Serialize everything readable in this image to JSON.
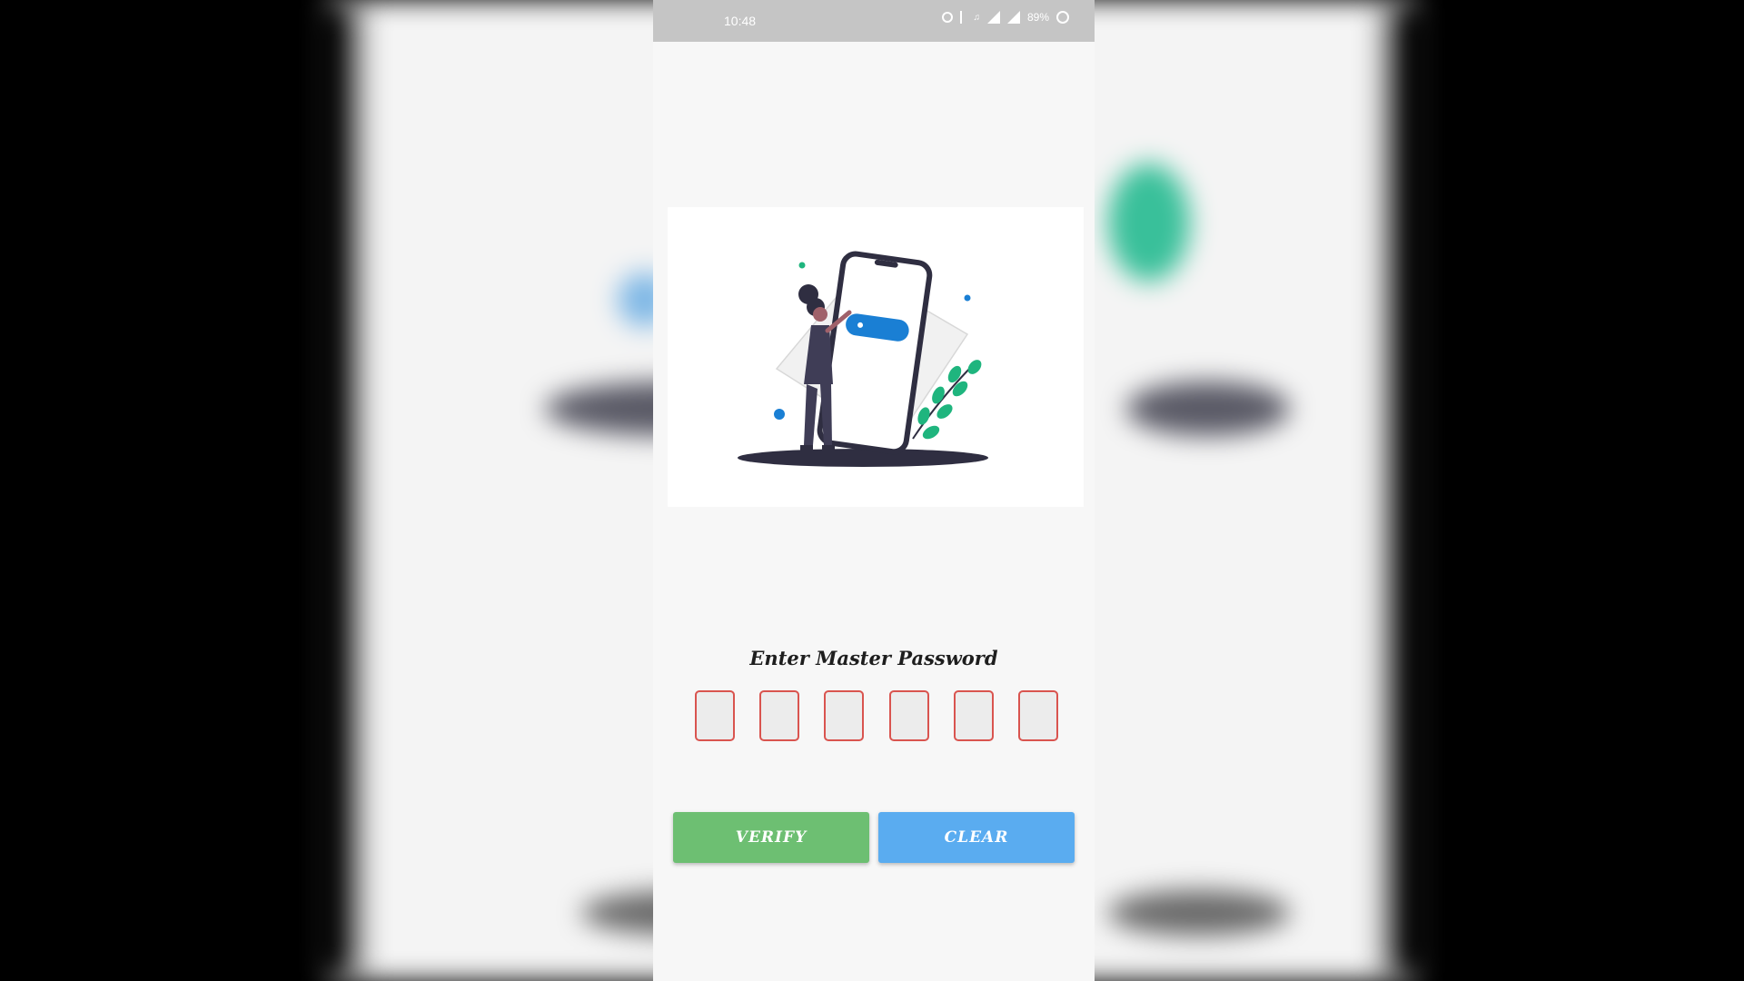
{
  "status_bar": {
    "time": "10:48",
    "battery": "89%"
  },
  "login": {
    "prompt": "Enter Master Password",
    "otp_digits": [
      "",
      "",
      "",
      "",
      "",
      ""
    ],
    "verify_label": "VERIFY",
    "clear_label": "CLEAR"
  },
  "colors": {
    "verify": "#6dbf72",
    "clear": "#5aacf0",
    "otp_border": "#d9544f",
    "accent_green": "#1fb57e",
    "accent_blue": "#1a7fd4"
  },
  "icons": [
    "alarm-icon",
    "bluetooth-icon",
    "volume-icon",
    "signal-icon",
    "battery-icon",
    "loading-ring-icon"
  ]
}
